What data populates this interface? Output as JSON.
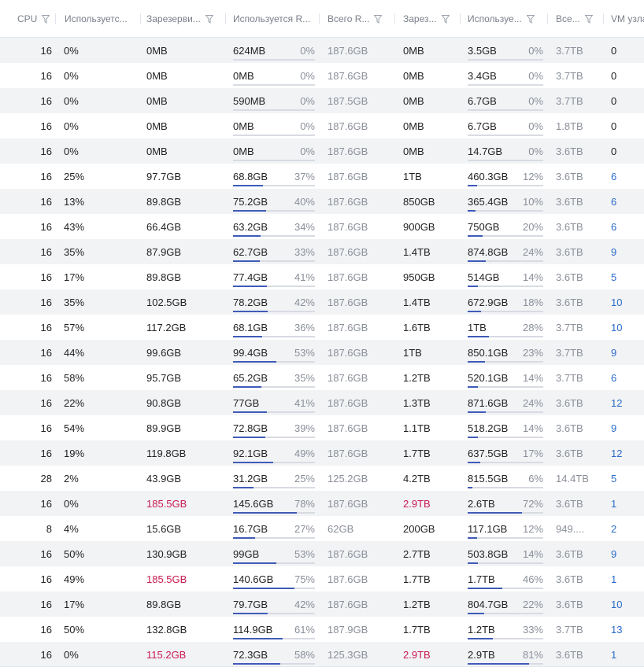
{
  "headers": [
    {
      "label": "CPU"
    },
    {
      "label": "Используетс..."
    },
    {
      "label": "Зарезерви..."
    },
    {
      "label": "Используется R..."
    },
    {
      "label": "Всего R..."
    },
    {
      "label": "Зарез..."
    },
    {
      "label": "Используе..."
    },
    {
      "label": "Все..."
    },
    {
      "label": "VM узла"
    }
  ],
  "colors": {
    "accent": "#3f5bb8",
    "link": "#2a6cc9",
    "danger": "#c8194f",
    "stripe": "#f2f3f5"
  },
  "icons": {
    "filter": "funnel-filter-icon"
  },
  "rows": [
    {
      "cpu": "16",
      "cpu_used": "0%",
      "ram_reserved": "0MB",
      "ram_used": "624MB",
      "ram_used_pct": "0%",
      "ram_used_fill": 0,
      "ram_total": "187.6GB",
      "disk_reserved": "0MB",
      "disk_used": "3.5GB",
      "disk_used_pct": "0%",
      "disk_used_fill": 0,
      "disk_total": "3.7TB",
      "vm_count": "0"
    },
    {
      "cpu": "16",
      "cpu_used": "0%",
      "ram_reserved": "0MB",
      "ram_used": "0MB",
      "ram_used_pct": "0%",
      "ram_used_fill": 0,
      "ram_total": "187.6GB",
      "disk_reserved": "0MB",
      "disk_used": "3.4GB",
      "disk_used_pct": "0%",
      "disk_used_fill": 0,
      "disk_total": "3.7TB",
      "vm_count": "0"
    },
    {
      "cpu": "16",
      "cpu_used": "0%",
      "ram_reserved": "0MB",
      "ram_used": "590MB",
      "ram_used_pct": "0%",
      "ram_used_fill": 0,
      "ram_total": "187.5GB",
      "disk_reserved": "0MB",
      "disk_used": "6.7GB",
      "disk_used_pct": "0%",
      "disk_used_fill": 0,
      "disk_total": "3.7TB",
      "vm_count": "0"
    },
    {
      "cpu": "16",
      "cpu_used": "0%",
      "ram_reserved": "0MB",
      "ram_used": "0MB",
      "ram_used_pct": "0%",
      "ram_used_fill": 0,
      "ram_total": "187.6GB",
      "disk_reserved": "0MB",
      "disk_used": "6.7GB",
      "disk_used_pct": "0%",
      "disk_used_fill": 0,
      "disk_total": "1.8TB",
      "vm_count": "0"
    },
    {
      "cpu": "16",
      "cpu_used": "0%",
      "ram_reserved": "0MB",
      "ram_used": "0MB",
      "ram_used_pct": "0%",
      "ram_used_fill": 0,
      "ram_total": "187.6GB",
      "disk_reserved": "0MB",
      "disk_used": "14.7GB",
      "disk_used_pct": "0%",
      "disk_used_fill": 0,
      "disk_total": "3.6TB",
      "vm_count": "0"
    },
    {
      "cpu": "16",
      "cpu_used": "25%",
      "ram_reserved": "97.7GB",
      "ram_used": "68.8GB",
      "ram_used_pct": "37%",
      "ram_used_fill": 37,
      "ram_total": "187.6GB",
      "disk_reserved": "1TB",
      "disk_used": "460.3GB",
      "disk_used_pct": "12%",
      "disk_used_fill": 12,
      "disk_total": "3.6TB",
      "vm_count": "6"
    },
    {
      "cpu": "16",
      "cpu_used": "13%",
      "ram_reserved": "89.8GB",
      "ram_used": "75.2GB",
      "ram_used_pct": "40%",
      "ram_used_fill": 40,
      "ram_total": "187.6GB",
      "disk_reserved": "850GB",
      "disk_used": "365.4GB",
      "disk_used_pct": "10%",
      "disk_used_fill": 10,
      "disk_total": "3.6TB",
      "vm_count": "6"
    },
    {
      "cpu": "16",
      "cpu_used": "43%",
      "ram_reserved": "66.4GB",
      "ram_used": "63.2GB",
      "ram_used_pct": "34%",
      "ram_used_fill": 34,
      "ram_total": "187.6GB",
      "disk_reserved": "900GB",
      "disk_used": "750GB",
      "disk_used_pct": "20%",
      "disk_used_fill": 20,
      "disk_total": "3.6TB",
      "vm_count": "6"
    },
    {
      "cpu": "16",
      "cpu_used": "35%",
      "ram_reserved": "87.9GB",
      "ram_used": "62.7GB",
      "ram_used_pct": "33%",
      "ram_used_fill": 33,
      "ram_total": "187.6GB",
      "disk_reserved": "1.4TB",
      "disk_used": "874.8GB",
      "disk_used_pct": "24%",
      "disk_used_fill": 24,
      "disk_total": "3.6TB",
      "vm_count": "9"
    },
    {
      "cpu": "16",
      "cpu_used": "17%",
      "ram_reserved": "89.8GB",
      "ram_used": "77.4GB",
      "ram_used_pct": "41%",
      "ram_used_fill": 41,
      "ram_total": "187.6GB",
      "disk_reserved": "950GB",
      "disk_used": "514GB",
      "disk_used_pct": "14%",
      "disk_used_fill": 14,
      "disk_total": "3.6TB",
      "vm_count": "5"
    },
    {
      "cpu": "16",
      "cpu_used": "35%",
      "ram_reserved": "102.5GB",
      "ram_used": "78.2GB",
      "ram_used_pct": "42%",
      "ram_used_fill": 42,
      "ram_total": "187.6GB",
      "disk_reserved": "1.4TB",
      "disk_used": "672.9GB",
      "disk_used_pct": "18%",
      "disk_used_fill": 18,
      "disk_total": "3.6TB",
      "vm_count": "10"
    },
    {
      "cpu": "16",
      "cpu_used": "57%",
      "ram_reserved": "117.2GB",
      "ram_used": "68.1GB",
      "ram_used_pct": "36%",
      "ram_used_fill": 36,
      "ram_total": "187.6GB",
      "disk_reserved": "1.6TB",
      "disk_used": "1TB",
      "disk_used_pct": "28%",
      "disk_used_fill": 28,
      "disk_total": "3.7TB",
      "vm_count": "10"
    },
    {
      "cpu": "16",
      "cpu_used": "44%",
      "ram_reserved": "99.6GB",
      "ram_used": "99.4GB",
      "ram_used_pct": "53%",
      "ram_used_fill": 53,
      "ram_total": "187.6GB",
      "disk_reserved": "1TB",
      "disk_used": "850.1GB",
      "disk_used_pct": "23%",
      "disk_used_fill": 23,
      "disk_total": "3.7TB",
      "vm_count": "9"
    },
    {
      "cpu": "16",
      "cpu_used": "58%",
      "ram_reserved": "95.7GB",
      "ram_used": "65.2GB",
      "ram_used_pct": "35%",
      "ram_used_fill": 35,
      "ram_total": "187.6GB",
      "disk_reserved": "1.2TB",
      "disk_used": "520.1GB",
      "disk_used_pct": "14%",
      "disk_used_fill": 14,
      "disk_total": "3.7TB",
      "vm_count": "6"
    },
    {
      "cpu": "16",
      "cpu_used": "22%",
      "ram_reserved": "90.8GB",
      "ram_used": "77GB",
      "ram_used_pct": "41%",
      "ram_used_fill": 41,
      "ram_total": "187.6GB",
      "disk_reserved": "1.3TB",
      "disk_used": "871.6GB",
      "disk_used_pct": "24%",
      "disk_used_fill": 24,
      "disk_total": "3.6TB",
      "vm_count": "12"
    },
    {
      "cpu": "16",
      "cpu_used": "54%",
      "ram_reserved": "89.9GB",
      "ram_used": "72.8GB",
      "ram_used_pct": "39%",
      "ram_used_fill": 39,
      "ram_total": "187.6GB",
      "disk_reserved": "1.1TB",
      "disk_used": "518.2GB",
      "disk_used_pct": "14%",
      "disk_used_fill": 14,
      "disk_total": "3.6TB",
      "vm_count": "9"
    },
    {
      "cpu": "16",
      "cpu_used": "19%",
      "ram_reserved": "119.8GB",
      "ram_used": "92.1GB",
      "ram_used_pct": "49%",
      "ram_used_fill": 49,
      "ram_total": "187.6GB",
      "disk_reserved": "1.7TB",
      "disk_used": "637.5GB",
      "disk_used_pct": "17%",
      "disk_used_fill": 17,
      "disk_total": "3.6TB",
      "vm_count": "12"
    },
    {
      "cpu": "28",
      "cpu_used": "2%",
      "ram_reserved": "43.9GB",
      "ram_used": "31.2GB",
      "ram_used_pct": "25%",
      "ram_used_fill": 25,
      "ram_total": "125.2GB",
      "disk_reserved": "4.2TB",
      "disk_used": "815.5GB",
      "disk_used_pct": "6%",
      "disk_used_fill": 6,
      "disk_total": "14.4TB",
      "vm_count": "5"
    },
    {
      "cpu": "16",
      "cpu_used": "0%",
      "ram_reserved": "185.5GB",
      "ram_reserved_alert": true,
      "ram_used": "145.6GB",
      "ram_used_pct": "78%",
      "ram_used_fill": 78,
      "ram_total": "187.6GB",
      "disk_reserved": "2.9TB",
      "disk_reserved_alert": true,
      "disk_used": "2.6TB",
      "disk_used_pct": "72%",
      "disk_used_fill": 72,
      "disk_total": "3.6TB",
      "vm_count": "1"
    },
    {
      "cpu": "8",
      "cpu_used": "4%",
      "ram_reserved": "15.6GB",
      "ram_used": "16.7GB",
      "ram_used_pct": "27%",
      "ram_used_fill": 27,
      "ram_total": "62GB",
      "disk_reserved": "200GB",
      "disk_used": "117.1GB",
      "disk_used_pct": "12%",
      "disk_used_fill": 12,
      "disk_total": "949....",
      "vm_count": "2"
    },
    {
      "cpu": "16",
      "cpu_used": "50%",
      "ram_reserved": "130.9GB",
      "ram_used": "99GB",
      "ram_used_pct": "53%",
      "ram_used_fill": 53,
      "ram_total": "187.6GB",
      "disk_reserved": "2.7TB",
      "disk_used": "503.8GB",
      "disk_used_pct": "14%",
      "disk_used_fill": 14,
      "disk_total": "3.6TB",
      "vm_count": "9"
    },
    {
      "cpu": "16",
      "cpu_used": "49%",
      "ram_reserved": "185.5GB",
      "ram_reserved_alert": true,
      "ram_used": "140.6GB",
      "ram_used_pct": "75%",
      "ram_used_fill": 75,
      "ram_total": "187.6GB",
      "disk_reserved": "1.7TB",
      "disk_used": "1.7TB",
      "disk_used_pct": "46%",
      "disk_used_fill": 46,
      "disk_total": "3.6TB",
      "vm_count": "1"
    },
    {
      "cpu": "16",
      "cpu_used": "17%",
      "ram_reserved": "89.8GB",
      "ram_used": "79.7GB",
      "ram_used_pct": "42%",
      "ram_used_fill": 42,
      "ram_total": "187.6GB",
      "disk_reserved": "1.2TB",
      "disk_used": "804.7GB",
      "disk_used_pct": "22%",
      "disk_used_fill": 22,
      "disk_total": "3.6TB",
      "vm_count": "10"
    },
    {
      "cpu": "16",
      "cpu_used": "50%",
      "ram_reserved": "132.8GB",
      "ram_used": "114.9GB",
      "ram_used_pct": "61%",
      "ram_used_fill": 61,
      "ram_total": "187.9GB",
      "disk_reserved": "1.7TB",
      "disk_used": "1.2TB",
      "disk_used_pct": "33%",
      "disk_used_fill": 33,
      "disk_total": "3.7TB",
      "vm_count": "13"
    },
    {
      "cpu": "16",
      "cpu_used": "0%",
      "ram_reserved": "115.2GB",
      "ram_reserved_alert": true,
      "ram_used": "72.3GB",
      "ram_used_pct": "58%",
      "ram_used_fill": 58,
      "ram_total": "125.3GB",
      "disk_reserved": "2.9TB",
      "disk_reserved_alert": true,
      "disk_used": "2.9TB",
      "disk_used_pct": "81%",
      "disk_used_fill": 81,
      "disk_total": "3.6TB",
      "vm_count": "1"
    }
  ]
}
